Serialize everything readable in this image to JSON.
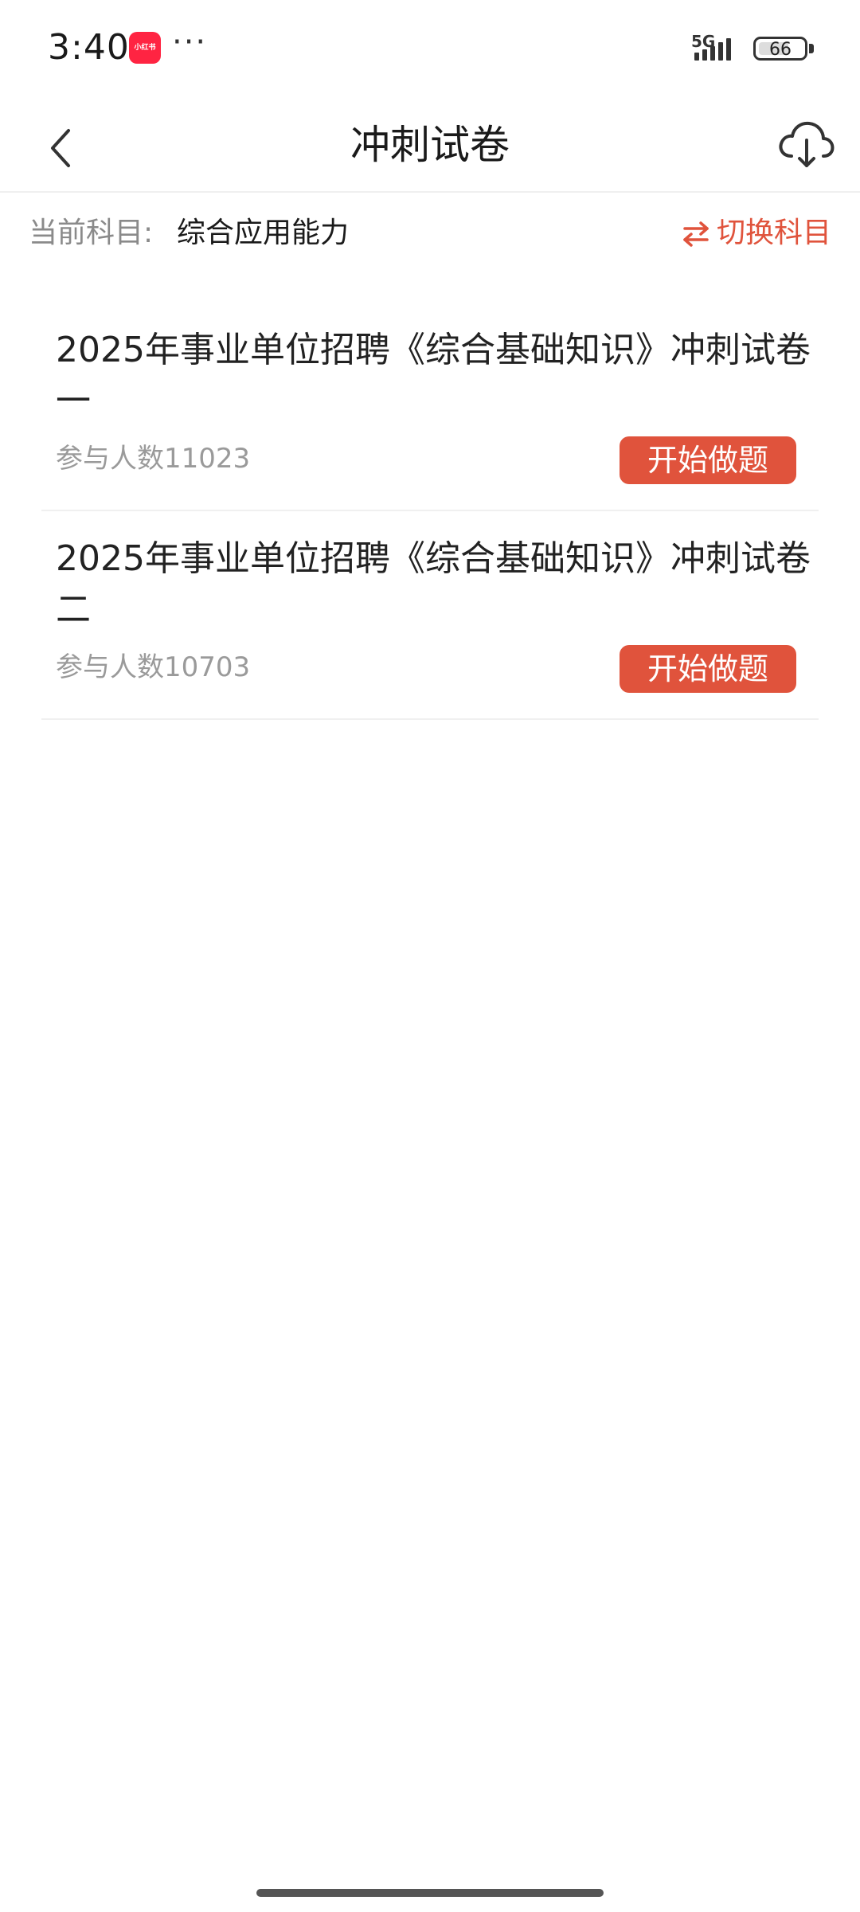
{
  "status_bar": {
    "time": "3:40",
    "app_badge": "小红书",
    "more": "···",
    "network": "5G",
    "battery": "66",
    "battery_level_percent": 66
  },
  "nav": {
    "title": "冲刺试卷"
  },
  "subject": {
    "label": "当前科目:",
    "value": "综合应用能力",
    "switch_label": "切换科目"
  },
  "papers": [
    {
      "title": "2025年事业单位招聘《综合基础知识》冲刺试卷一",
      "participants": "参与人数11023",
      "button": "开始做题"
    },
    {
      "title": "2025年事业单位招聘《综合基础知识》冲刺试卷二",
      "participants": "参与人数10703",
      "button": "开始做题"
    }
  ],
  "colors": {
    "accent": "#e0533c",
    "text_primary": "#222222",
    "text_secondary": "#9a9a9a"
  },
  "icons": {
    "back": "chevron-left-icon",
    "download": "cloud-download-icon",
    "switch": "swap-arrows-icon",
    "signal": "signal-bars-icon",
    "battery": "battery-icon"
  }
}
